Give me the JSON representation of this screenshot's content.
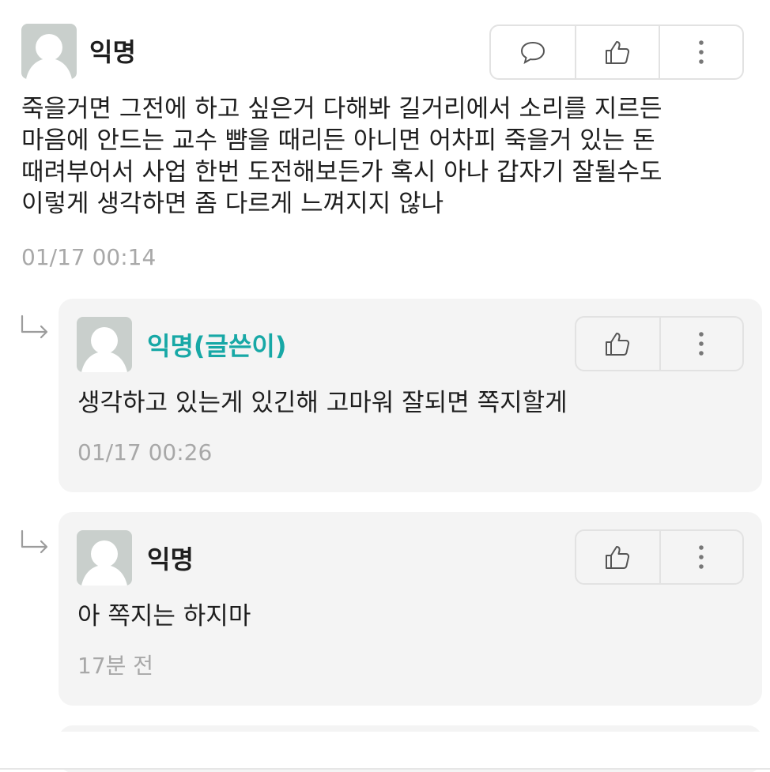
{
  "main_comment": {
    "author": "익명",
    "text": "죽을거면 그전에 하고 싶은거 다해봐 길거리에서 소리를 지르든\n마음에 안드는 교수 뺨을 때리든 아니면 어차피 죽을거 있는 돈\n때려부어서 사업 한번 도전해보든가 혹시 아나 갑자기 잘될수도\n이렇게 생각하면 좀 다르게 느껴지지 않나",
    "timestamp": "01/17 00:14",
    "icons": [
      "reply-icon",
      "thumbs-up-icon",
      "more-icon"
    ]
  },
  "replies": [
    {
      "author": "익명(글쓴이)",
      "is_author": true,
      "text": "생각하고 있는게 있긴해 고마워 잘되면 쪽지할게",
      "timestamp": "01/17 00:26",
      "icons": [
        "thumbs-up-icon",
        "more-icon"
      ]
    },
    {
      "author": "익명",
      "is_author": false,
      "text": "아 쪽지는 하지마",
      "timestamp": "17분 전",
      "icons": [
        "thumbs-up-icon",
        "more-icon"
      ]
    }
  ],
  "colors": {
    "author_accent": "#17a8a6",
    "card_background": "#f4f4f4",
    "timestamp": "#a8a8a8",
    "avatar": "#c9cfcc"
  }
}
